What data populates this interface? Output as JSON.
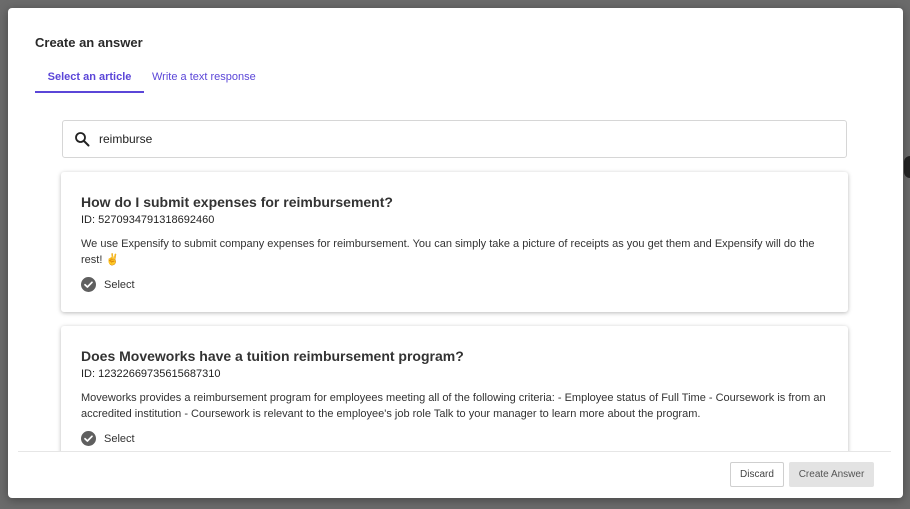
{
  "modal": {
    "title": "Create an answer"
  },
  "tabs": [
    {
      "label": "Select an article",
      "active": true
    },
    {
      "label": "Write a text response",
      "active": false
    }
  ],
  "search": {
    "value": "reimburse",
    "icon": "search-icon"
  },
  "results": [
    {
      "title": "How do I submit expenses for reimbursement?",
      "id": "ID: 5270934791318692460",
      "description": "We use Expensify to submit company expenses for reimbursement. You can simply take a picture of receipts as you get them and Expensify will do the rest! ✌",
      "select_label": "Select"
    },
    {
      "title": "Does Moveworks have a tuition reimbursement program?",
      "id": "ID: 12322669735615687310",
      "description": "Moveworks provides a reimbursement program for employees meeting all of the following criteria: - Employee status of Full Time - Coursework is from an accredited institution - Coursework is relevant to the employee's job role Talk to your manager to learn more about the program.",
      "select_label": "Select"
    }
  ],
  "footer": {
    "discard_label": "Discard",
    "create_label": "Create Answer"
  },
  "colors": {
    "accent": "#5b46d8",
    "check": "#5f5f5f"
  }
}
